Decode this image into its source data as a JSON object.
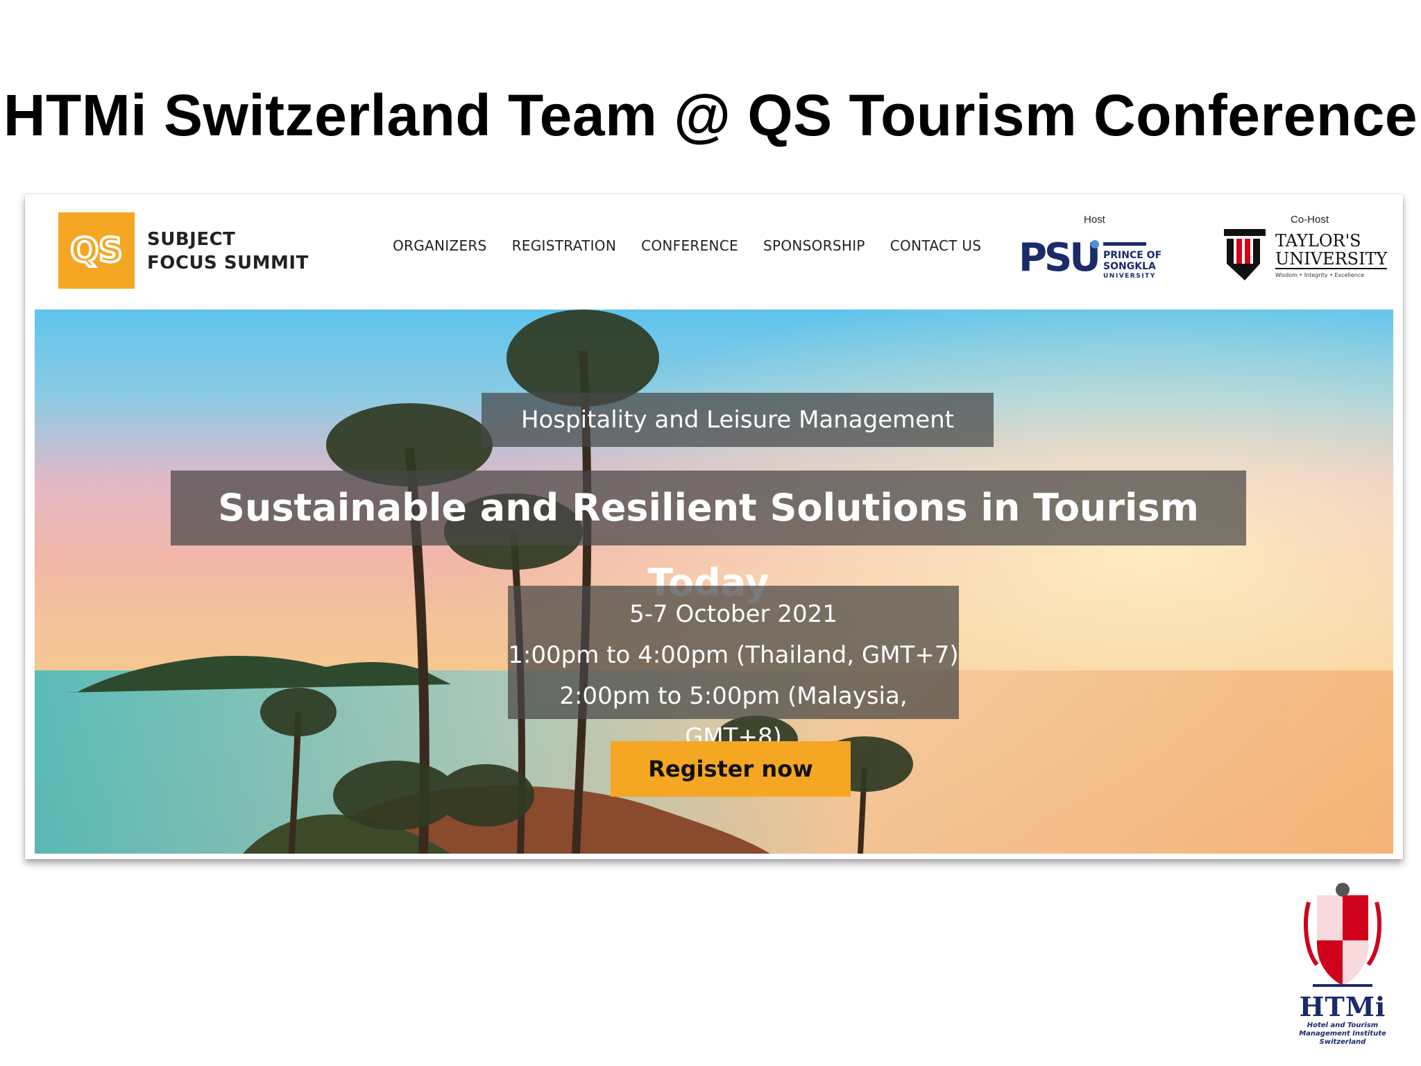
{
  "slide": {
    "title": "HTMi Switzerland Team @ QS Tourism Conference"
  },
  "site": {
    "logo_text": "QS",
    "summit_line1": "SUBJECT",
    "summit_line2": "FOCUS SUMMIT",
    "nav": [
      "ORGANIZERS",
      "REGISTRATION",
      "CONFERENCE",
      "SPONSORSHIP",
      "CONTACT US"
    ],
    "host_label": "Host",
    "host_logo_text": "PSU",
    "host_name_lines": [
      "PRINCE OF",
      "SONGKLA",
      "UNIVERSITY"
    ],
    "cohost_label": "Co-Host",
    "cohost_name_line1": "TAYLOR'S",
    "cohost_name_line2": "UNIVERSITY",
    "cohost_motto": "Wisdom • Integrity • Excellence"
  },
  "hero": {
    "subtitle": "Hospitality and Leisure Management",
    "title": "Sustainable and Resilient Solutions in Tourism Today",
    "date": "5-7 October 2021",
    "time_thailand": "1:00pm to 4:00pm (Thailand, GMT+7)",
    "time_malaysia": "2:00pm to 5:00pm (Malaysia, GMT+8)",
    "register_label": "Register now"
  },
  "footer_logo": {
    "name": "HTMi",
    "sub_lines": [
      "Hotel and Tourism",
      "Management Institute",
      "Switzerland"
    ]
  },
  "colors": {
    "qs_orange": "#f5a623",
    "overlay": "#464646",
    "psu_blue": "#1b2a6b",
    "taylors_red": "#d0021b",
    "htmi_navy": "#1a2a6c"
  }
}
